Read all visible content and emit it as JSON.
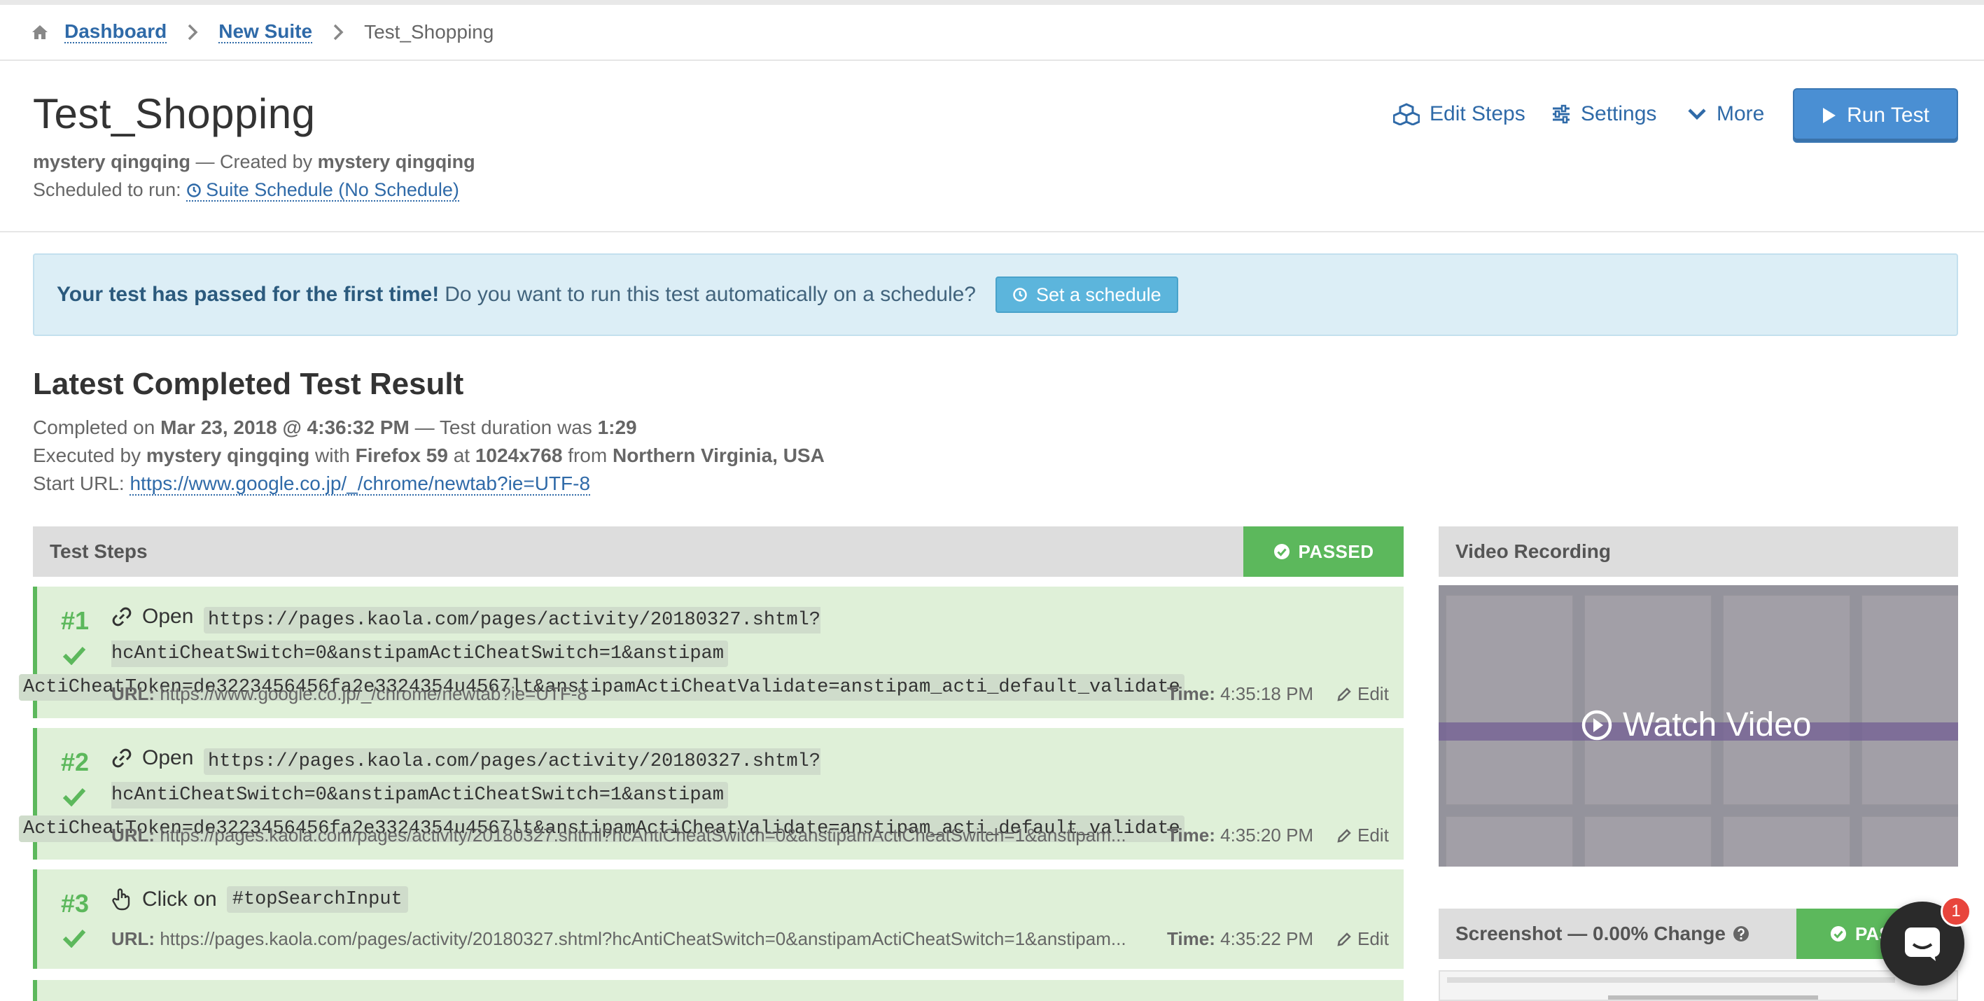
{
  "breadcrumb": {
    "items": [
      "Dashboard",
      "New Suite"
    ],
    "current": "Test_Shopping"
  },
  "header": {
    "title": "Test_Shopping",
    "owner": "mystery qingqing",
    "created_by_label": "— Created by",
    "creator": "mystery qingqing",
    "scheduled_label": "Scheduled to run:",
    "schedule_link": "Suite Schedule (No Schedule)"
  },
  "actions": {
    "edit_steps": "Edit Steps",
    "settings": "Settings",
    "more": "More",
    "run_test": "Run Test"
  },
  "alert": {
    "bold": "Your test has passed for the first time!",
    "text": "Do you want to run this test automatically on a schedule?",
    "button": "Set a schedule"
  },
  "result": {
    "title": "Latest Completed Test Result",
    "completed_label": "Completed on",
    "completed_at": "Mar 23, 2018 @ 4:36:32 PM",
    "duration_label": "— Test duration was",
    "duration": "1:29",
    "executed_label": "Executed by",
    "executor": "mystery qingqing",
    "with_label": "with",
    "browser": "Firefox 59",
    "at_label": "at",
    "resolution": "1024x768",
    "from_label": "from",
    "location": "Northern Virginia, USA",
    "start_url_label": "Start URL:",
    "start_url": "https://www.google.co.jp/_/chrome/newtab?ie=UTF-8"
  },
  "steps_panel": {
    "title": "Test Steps",
    "status": "PASSED"
  },
  "steps": [
    {
      "num": "#1",
      "action": "Open",
      "target_line1": "https://pages.kaola.com/pages/activity/20180327.shtml?hcAntiCheatSwitch=0&anstipamActiCheatSwitch=1&anstipam",
      "target_line2": "ActiCheatToken=de3223456456fa2e3324354u4567lt&anstipamActiCheatValidate=anstipam_acti_default_validate",
      "url_label": "URL:",
      "url": "https://www.google.co.jp/_/chrome/newtab?ie=UTF-8",
      "time_label": "Time:",
      "time": "4:35:18 PM",
      "edit": "Edit"
    },
    {
      "num": "#2",
      "action": "Open",
      "target_line1": "https://pages.kaola.com/pages/activity/20180327.shtml?hcAntiCheatSwitch=0&anstipamActiCheatSwitch=1&anstipam",
      "target_line2": "ActiCheatToken=de3223456456fa2e3324354u4567lt&anstipamActiCheatValidate=anstipam_acti_default_validate",
      "url_label": "URL:",
      "url": "https://pages.kaola.com/pages/activity/20180327.shtml?hcAntiCheatSwitch=0&anstipamActiCheatSwitch=1&anstipam...",
      "time_label": "Time:",
      "time": "4:35:20 PM",
      "edit": "Edit"
    },
    {
      "num": "#3",
      "action": "Click on",
      "target": "#topSearchInput",
      "url_label": "URL:",
      "url": "https://pages.kaola.com/pages/activity/20180327.shtml?hcAntiCheatSwitch=0&anstipamActiCheatSwitch=1&anstipam...",
      "time_label": "Time:",
      "time": "4:35:22 PM",
      "edit": "Edit"
    }
  ],
  "video": {
    "title": "Video Recording",
    "watch": "Watch Video"
  },
  "screenshot": {
    "title": "Screenshot — 0.00% Change",
    "status": "PASSED"
  },
  "chat": {
    "badge": "1"
  },
  "colors": {
    "link": "#2f6aa8",
    "success": "#5cb85c",
    "success_bg": "#dff0d8",
    "primary": "#4a8fd3",
    "info_bg": "#dceef6"
  }
}
